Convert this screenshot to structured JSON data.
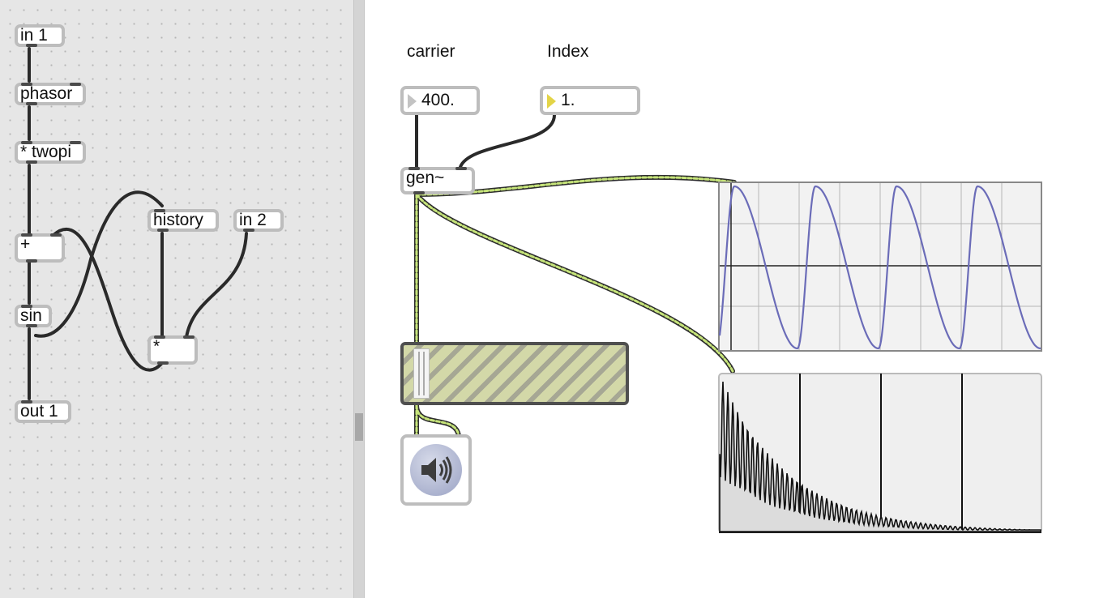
{
  "gen_patcher": {
    "objects": {
      "in1": "in 1",
      "phasor": "phasor",
      "twopi": "* twopi",
      "plus": "+",
      "sin": "sin",
      "history": "history",
      "in2": "in 2",
      "mult": "*",
      "out1": "out 1"
    }
  },
  "main_patcher": {
    "labels": {
      "carrier": "carrier",
      "index": "Index"
    },
    "carrier_number": "400.",
    "index_number": "1.",
    "gen_object": "gen~"
  },
  "icons": {
    "speaker": "speaker-icon",
    "gain_handle": "slider-handle-icon"
  },
  "colors": {
    "signal_cord": "#c6e47a",
    "scope_trace": "#6b6cb8",
    "gen_background": "#e6e6e6"
  }
}
